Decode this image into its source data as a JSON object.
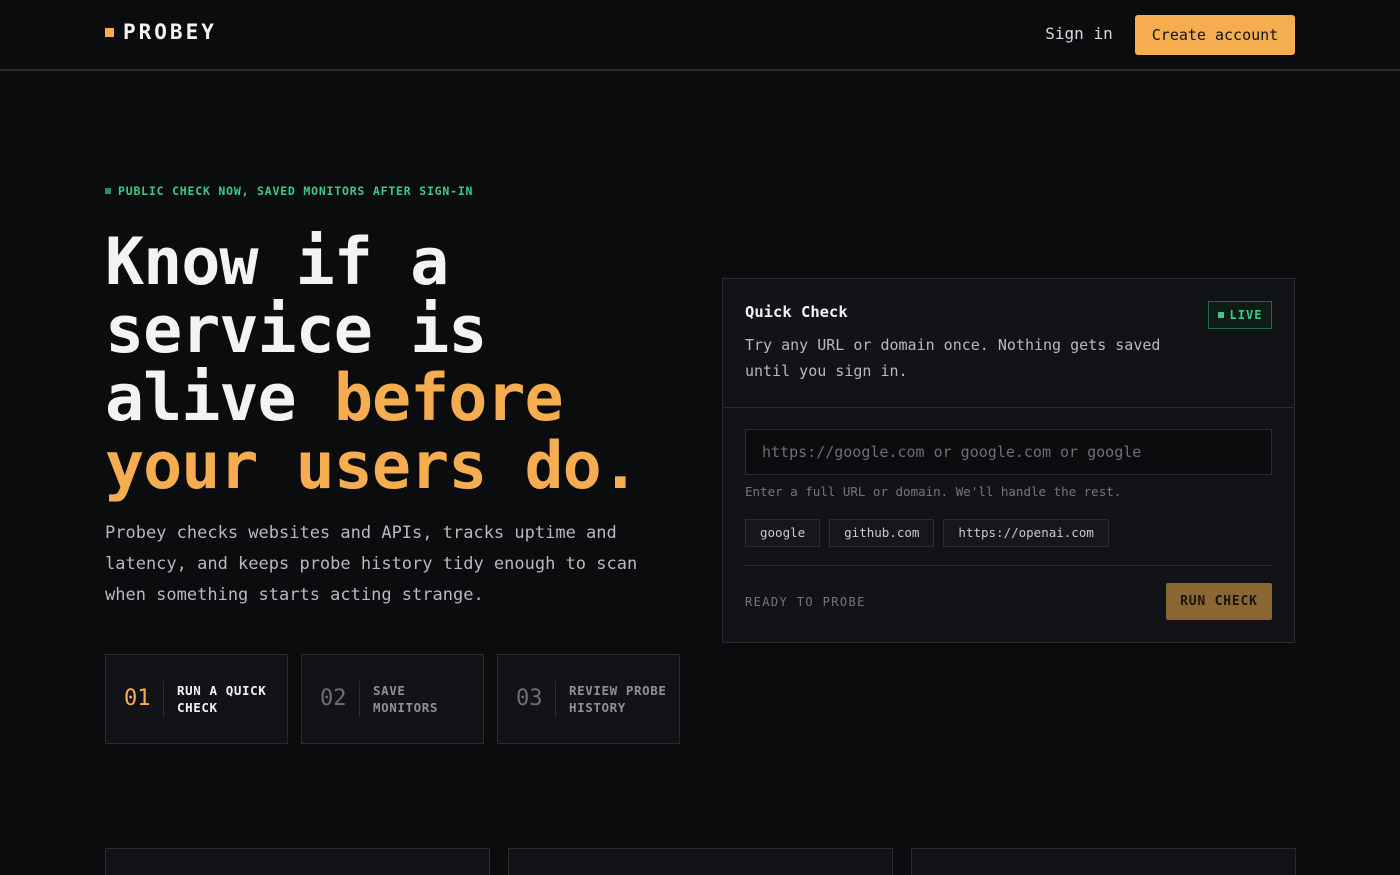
{
  "header": {
    "brand": "PROBEY",
    "sign_in": "Sign in",
    "create_account": "Create account"
  },
  "hero": {
    "eyebrow": "PUBLIC CHECK NOW, SAVED MONITORS AFTER SIGN-IN",
    "headline_line1": "Know if a",
    "headline_line2": "service is",
    "headline_line3_plain": "alive ",
    "headline_line3_accent": "before",
    "headline_line4_accent": "your users do.",
    "lede": "Probey checks websites and APIs, tracks uptime and latency, and keeps probe history tidy enough to scan when something starts acting strange.",
    "steps": [
      {
        "num": "01",
        "label": "RUN A QUICK CHECK",
        "active": true
      },
      {
        "num": "02",
        "label": "SAVE MONITORS",
        "active": false
      },
      {
        "num": "03",
        "label": "REVIEW PROBE HISTORY",
        "active": false
      }
    ]
  },
  "quick_check": {
    "title": "Quick Check",
    "badge": "LIVE",
    "description": "Try any URL or domain once. Nothing gets saved until you sign in.",
    "input_value": "",
    "input_placeholder": "https://google.com or google.com or google",
    "hint": "Enter a full URL or domain. We'll handle the rest.",
    "chips": [
      "google",
      "github.com",
      "https://openai.com"
    ],
    "status": "READY TO PROBE",
    "run_label": "RUN CHECK"
  },
  "colors": {
    "accent": "#f5ad4f",
    "live_green": "#3dc98a",
    "background": "#0b0c0e",
    "surface": "#121316"
  },
  "icons": {
    "brand_mark": "square-mark-icon",
    "eyebrow_dot": "square-dot-icon",
    "live_dot": "live-dot-icon"
  }
}
